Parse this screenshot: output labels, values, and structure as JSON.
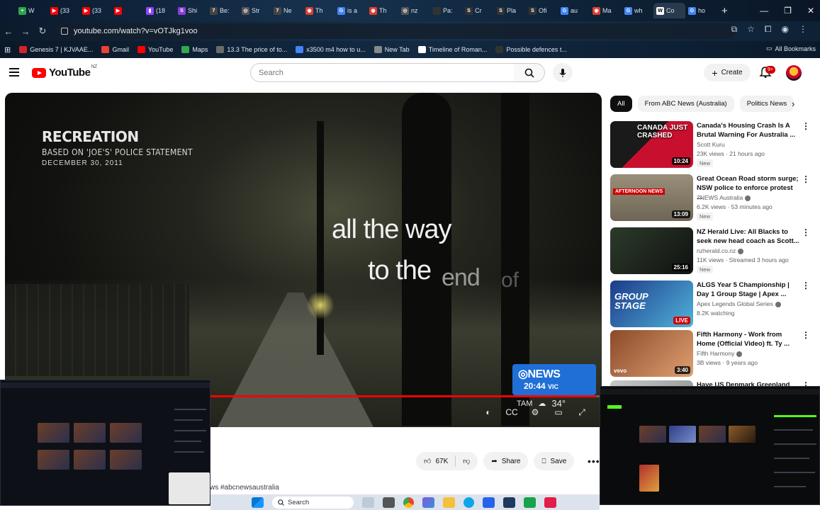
{
  "browser": {
    "tabs": [
      {
        "label": "W",
        "fav": "#2da44e",
        "glyph": "+"
      },
      {
        "label": "(33",
        "fav": "#ff0000",
        "glyph": "▶"
      },
      {
        "label": "(33",
        "fav": "#ff0000",
        "glyph": "▶"
      },
      {
        "label": "",
        "fav": "#ff0000",
        "glyph": "▶"
      },
      {
        "label": "(18",
        "fav": "#9146ff",
        "glyph": "▮"
      },
      {
        "label": "Shi",
        "fav": "#8c3bd6",
        "glyph": "S"
      },
      {
        "label": "Be:",
        "fav": "#444",
        "glyph": "7"
      },
      {
        "label": "Str",
        "fav": "#555",
        "glyph": "◎"
      },
      {
        "label": "Ne",
        "fav": "#444",
        "glyph": "7"
      },
      {
        "label": "Th",
        "fav": "#e03c31",
        "glyph": "◉"
      },
      {
        "label": "is a",
        "fav": "#4285f4",
        "glyph": "G"
      },
      {
        "label": "Th",
        "fav": "#e03c31",
        "glyph": "◉"
      },
      {
        "label": "nz",
        "fav": "#555",
        "glyph": "◎"
      },
      {
        "label": "Pa:",
        "fav": "#333",
        "glyph": ""
      },
      {
        "label": "Cr",
        "fav": "#333",
        "glyph": "S"
      },
      {
        "label": "Pla",
        "fav": "#333",
        "glyph": "S"
      },
      {
        "label": "Ofi",
        "fav": "#333",
        "glyph": "S"
      },
      {
        "label": "au",
        "fav": "#4285f4",
        "glyph": "G"
      },
      {
        "label": "Ma",
        "fav": "#e03c31",
        "glyph": "◉"
      },
      {
        "label": "wh",
        "fav": "#4285f4",
        "glyph": "G"
      },
      {
        "label": "Co",
        "fav": "#fff",
        "glyph": "W"
      },
      {
        "label": "ho",
        "fav": "#4285f4",
        "glyph": "G"
      }
    ],
    "url": "youtube.com/watch?v=vOTJkg1voo",
    "bookmarks": [
      {
        "label": "Genesis 7 | KJVAAE...",
        "color": "#d2232a"
      },
      {
        "label": "Gmail",
        "color": "#ea4335"
      },
      {
        "label": "YouTube",
        "color": "#ff0000"
      },
      {
        "label": "Maps",
        "color": "#34a853"
      },
      {
        "label": "13.3 The price of to...",
        "color": "#6b6b6b"
      },
      {
        "label": "x3500 m4 how to u...",
        "color": "#4285f4"
      },
      {
        "label": "New Tab",
        "color": "#888"
      },
      {
        "label": "Timeline of Roman...",
        "color": "#fff"
      },
      {
        "label": "Possible defences t...",
        "color": "#333"
      }
    ],
    "all_bookmarks": "All Bookmarks"
  },
  "youtube": {
    "logo": "YouTube",
    "region": "NZ",
    "search_placeholder": "Search",
    "create_label": "Create",
    "notification_count": "9+"
  },
  "video": {
    "overlay_title": "RECREATION",
    "overlay_subtitle": "BASED ON 'JOE'S' POLICE STATEMENT",
    "overlay_date": "DECEMBER 30, 2011",
    "lyric_line1": "all the way",
    "lyric_line2": "to the",
    "lyric_fade1": "end",
    "lyric_fade2": "of",
    "news_brand": "NEWS",
    "news_time": "20:44",
    "news_region": "VIC",
    "weather_city": "TAM",
    "weather_temp": "34°",
    "progress_fraction": 0.99,
    "like_count": "67K",
    "share_label": "Share",
    "save_label": "Save",
    "hashtag": "#abcnewsaustralia"
  },
  "sidebar": {
    "chips": [
      "All",
      "From ABC News (Australia)",
      "Politics News"
    ],
    "recommendations": [
      {
        "title": "Canada's Housing Crash Is A Brutal Warning For Australia ...",
        "channel": "Scott Kuru",
        "verified": false,
        "meta": "23K views · 21 hours ago",
        "badge": "New",
        "duration": "10:24",
        "thumb_text": "CANADA JUST CRASHED",
        "thumb_bg": "linear-gradient(135deg,#1a1a1a 0 45%,#c8102e 45%)"
      },
      {
        "title": "Great Ocean Road storm surge; NSW police to enforce protest ...",
        "channel": "7NEWS Australia",
        "verified": true,
        "meta": "6.2K views · 53 minutes ago",
        "badge": "New",
        "duration": "13:09",
        "thumb_text": "AFTERNOON NEWS",
        "thumb_bg": "linear-gradient(180deg,#9a8f7a,#6e6555)"
      },
      {
        "title": "NZ Herald Live: All Blacks to seek new head coach as Scott...",
        "channel": "nzherald.co.nz",
        "verified": true,
        "meta": "11K views · Streamed 3 hours ago",
        "badge": "New",
        "duration": "25:16",
        "thumb_text": "",
        "thumb_bg": "linear-gradient(135deg,#2b3b2a,#111)"
      },
      {
        "title": "ALGS Year 5 Championship | Day 1 Group Stage | Apex ...",
        "channel": "Apex Legends Global Series",
        "verified": true,
        "meta": "8.2K watching",
        "badge": "",
        "duration": "LIVE",
        "thumb_text": "GROUP STAGE",
        "thumb_bg": "linear-gradient(135deg,#1d3a8a,#4fb3d9)"
      },
      {
        "title": "Fifth Harmony - Work from Home (Official Video) ft. Ty ...",
        "channel": "Fifth Harmony",
        "verified": true,
        "meta": "3B views · 9 years ago",
        "badge": "",
        "duration": "3:40",
        "thumb_text": "vevo",
        "thumb_bg": "linear-gradient(135deg,#8a4a2a,#e0a070)"
      },
      {
        "title": "Have US Denmark Greenland",
        "channel": "",
        "verified": false,
        "meta": "",
        "badge": "",
        "duration": "",
        "thumb_text": "",
        "thumb_bg": "linear-gradient(135deg,#c8c8c8,#8a8a8a)"
      }
    ]
  },
  "taskbar": {
    "search_label": "Search"
  },
  "colors": {
    "yt_red": "#ff0000",
    "abc_blue": "#1f6fd6"
  }
}
